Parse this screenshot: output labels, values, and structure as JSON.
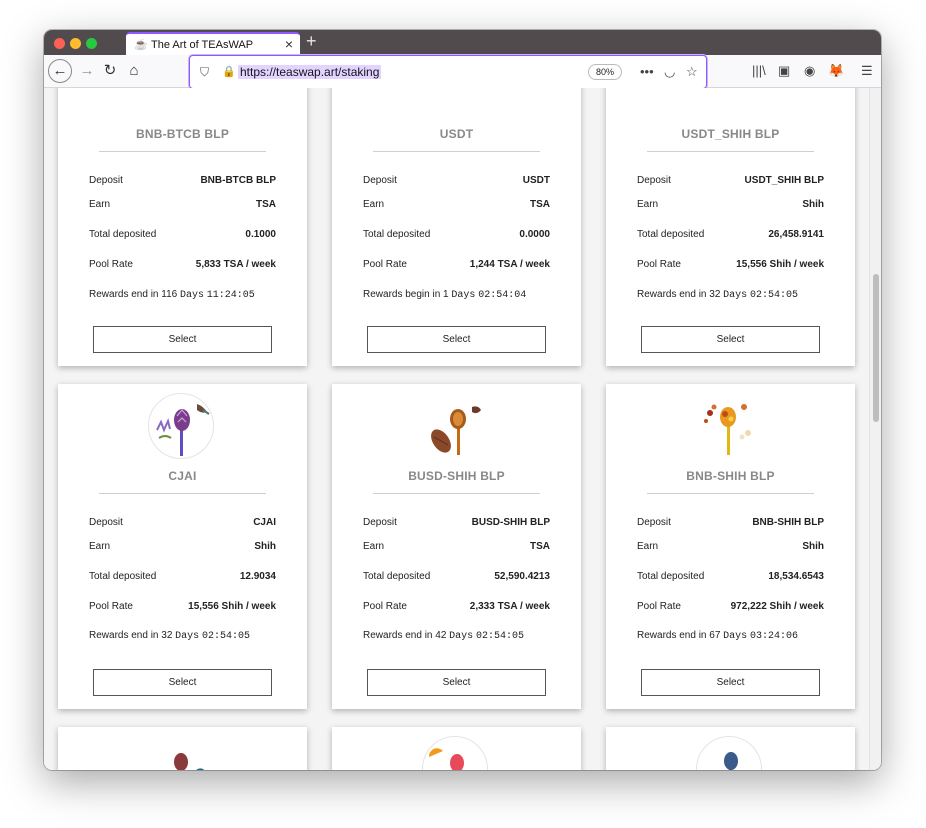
{
  "browser": {
    "tab_title": "The Art of TEAsWAP",
    "url": "https://teaswap.art/staking",
    "zoom": "80%"
  },
  "labels": {
    "deposit": "Deposit",
    "earn": "Earn",
    "total_deposited": "Total deposited",
    "pool_rate": "Pool Rate",
    "select": "Select",
    "days": "Days"
  },
  "pools": [
    {
      "name": "BNB-BTCB BLP",
      "deposit": "BNB-BTCB BLP",
      "earn": "TSA",
      "total_deposited": "0.1000",
      "pool_rate": "5,833 TSA / week",
      "rewards_prefix": "Rewards end in",
      "rewards_days": "116",
      "rewards_time": "11:24:05"
    },
    {
      "name": "USDT",
      "deposit": "USDT",
      "earn": "TSA",
      "total_deposited": "0.0000",
      "pool_rate": "1,244 TSA / week",
      "rewards_prefix": "Rewards begin in",
      "rewards_days": "1",
      "rewards_time": "02:54:04"
    },
    {
      "name": "USDT_SHIH BLP",
      "deposit": "USDT_SHIH BLP",
      "earn": "Shih",
      "total_deposited": "26,458.9141",
      "pool_rate": "15,556 Shih / week",
      "rewards_prefix": "Rewards end in",
      "rewards_days": "32",
      "rewards_time": "02:54:05"
    },
    {
      "name": "CJAI",
      "deposit": "CJAI",
      "earn": "Shih",
      "total_deposited": "12.9034",
      "pool_rate": "15,556 Shih / week",
      "rewards_prefix": "Rewards end in",
      "rewards_days": "32",
      "rewards_time": "02:54:05"
    },
    {
      "name": "BUSD-SHIH BLP",
      "deposit": "BUSD-SHIH BLP",
      "earn": "TSA",
      "total_deposited": "52,590.4213",
      "pool_rate": "2,333 TSA / week",
      "rewards_prefix": "Rewards end in",
      "rewards_days": "42",
      "rewards_time": "02:54:05"
    },
    {
      "name": "BNB-SHIH BLP",
      "deposit": "BNB-SHIH BLP",
      "earn": "Shih",
      "total_deposited": "18,534.6543",
      "pool_rate": "972,222 Shih / week",
      "rewards_prefix": "Rewards end in",
      "rewards_days": "67",
      "rewards_time": "03:24:06"
    }
  ],
  "colors": {
    "tab_accent": "#9059ff",
    "titlebar": "#524b4e"
  }
}
